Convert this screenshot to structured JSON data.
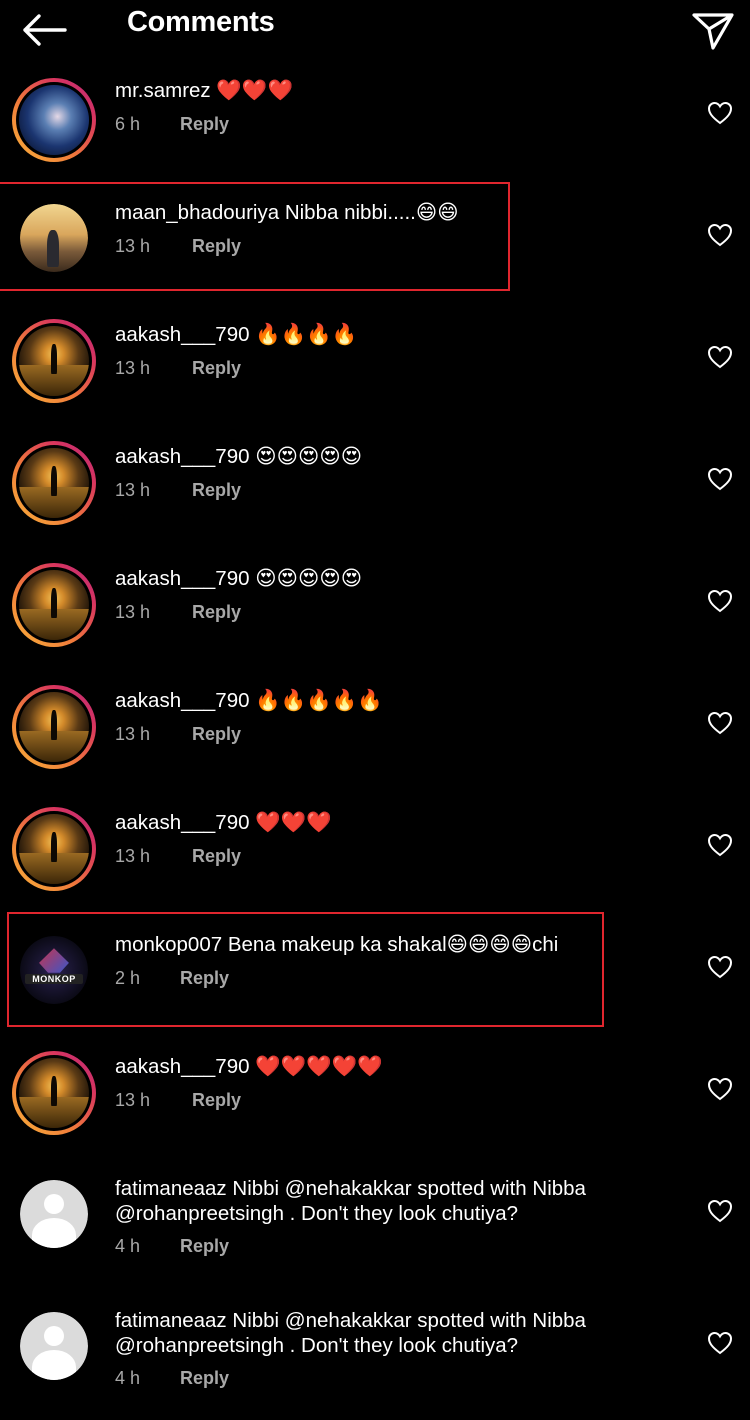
{
  "header": {
    "title": "Comments"
  },
  "icons": {
    "back": "arrow-left-icon",
    "send": "paper-plane-icon",
    "like": "heart-outline-icon"
  },
  "colors": {
    "background": "#000000",
    "meta_text": "#a8a8a8",
    "highlight_border": "#e0262e",
    "story_ring_start": "#f9b43a",
    "story_ring_end": "#b72a7e"
  },
  "reply_label": "Reply",
  "comments": [
    {
      "username": "mr.samrez",
      "text": "❤️❤️❤️",
      "time": "6 h",
      "highlighted": false
    },
    {
      "username": "maan_bhadouriya",
      "text": "Nibba nibbi.....😄😄",
      "time": "13 h",
      "highlighted": true
    },
    {
      "username": "aakash___790",
      "text": "🔥🔥🔥🔥",
      "time": "13 h",
      "highlighted": false
    },
    {
      "username": "aakash___790",
      "text": "😍😍😍😍😍",
      "time": "13 h",
      "highlighted": false
    },
    {
      "username": "aakash___790",
      "text": "😍😍😍😍😍",
      "time": "13 h",
      "highlighted": false
    },
    {
      "username": "aakash___790",
      "text": "🔥🔥🔥🔥🔥",
      "time": "13 h",
      "highlighted": false
    },
    {
      "username": "aakash___790",
      "text": "❤️❤️❤️",
      "time": "13 h",
      "highlighted": false
    },
    {
      "username": "monkop007",
      "text": "Bena makeup ka shakal😄😄😄😄chi",
      "time": "2 h",
      "highlighted": true,
      "avatar_badge": "MONKOP"
    },
    {
      "username": "aakash___790",
      "text": "❤️❤️❤️❤️❤️",
      "time": "13 h",
      "highlighted": false
    },
    {
      "username": "fatimaneaaz",
      "text": "Nibbi @nehakakkar spotted with Nibba @rohanpreetsingh . Don't they look chutiya?",
      "time": "4 h",
      "highlighted": false
    },
    {
      "username": "fatimaneaaz",
      "text": "Nibbi @nehakakkar spotted with Nibba @rohanpreetsingh . Don't they look chutiya?",
      "time": "4 h",
      "highlighted": false
    }
  ]
}
